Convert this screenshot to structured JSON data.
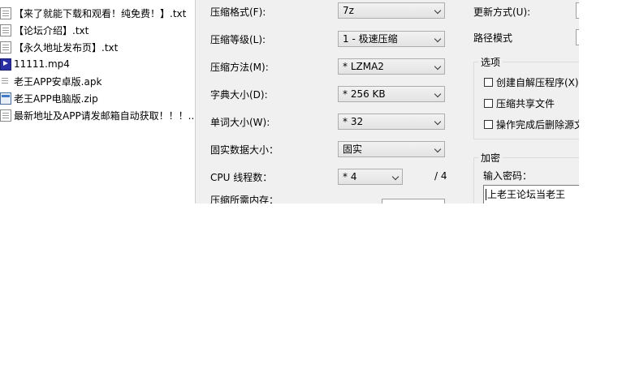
{
  "file_list": {
    "items": [
      {
        "name": "【来了就能下载和观看！纯免费！】.txt",
        "icon": "txt-file-icon"
      },
      {
        "name": "【论坛介绍】.txt",
        "icon": "txt-file-icon"
      },
      {
        "name": "【永久地址发布页】.txt",
        "icon": "txt-file-icon"
      },
      {
        "name": "11111.mp4",
        "icon": "video-file-icon"
      },
      {
        "name": "老王APP安卓版.apk",
        "icon": "apk-file-icon"
      },
      {
        "name": "老王APP电脑版.zip",
        "icon": "zip-file-icon"
      },
      {
        "name": "最新地址及APP请发邮箱自动获取！！！...",
        "icon": "txt-file-icon"
      }
    ]
  },
  "compress": {
    "format": {
      "label": "压缩格式(F):",
      "value": "7z"
    },
    "level": {
      "label": "压缩等级(L):",
      "value": "1 - 极速压缩"
    },
    "method": {
      "label": "压缩方法(M):",
      "value": "* LZMA2"
    },
    "dict_size": {
      "label": "字典大小(D):",
      "value": "* 256 KB"
    },
    "word_size": {
      "label": "单词大小(W):",
      "value": "* 32"
    },
    "solid_size": {
      "label": "固实数据大小：",
      "value": "固实"
    },
    "threads": {
      "label": "CPU 线程数：",
      "value": "* 4",
      "total": "/ 4"
    },
    "memory_label": "压缩所需内存："
  },
  "right_panel": {
    "update_mode_label": "更新方式(U):",
    "path_mode_label": "路径模式",
    "options": {
      "title": "选项",
      "sfx": "创建自解压程序(X)",
      "shared": "压缩共享文件",
      "delete_after": "操作完成后删除源文"
    },
    "encryption": {
      "title": "加密",
      "password_label": "输入密码：",
      "password_value": "上老王论坛当老王"
    }
  }
}
